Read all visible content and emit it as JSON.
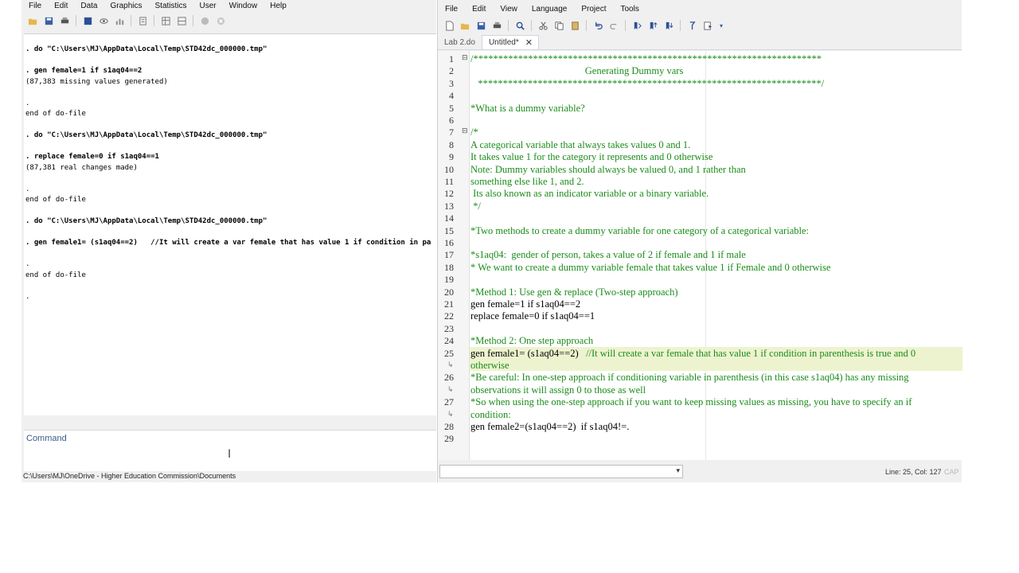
{
  "stata": {
    "menu": [
      "File",
      "Edit",
      "Data",
      "Graphics",
      "Statistics",
      "User",
      "Window",
      "Help"
    ],
    "results": [
      {
        "text": ". do \"C:\\Users\\MJ\\AppData\\Local\\Temp\\STD42dc_000000.tmp\"",
        "cmd": true
      },
      {
        "text": ". gen female=1 if s1aq04==2",
        "cmd": true
      },
      {
        "text": "(87,383 missing values generated)",
        "cmd": false
      },
      {
        "text": ".",
        "cmd": false
      },
      {
        "text": "end of do-file",
        "cmd": false
      },
      {
        "text": ". do \"C:\\Users\\MJ\\AppData\\Local\\Temp\\STD42dc_000000.tmp\"",
        "cmd": true
      },
      {
        "text": ". replace female=0 if s1aq04==1",
        "cmd": true
      },
      {
        "text": "(87,381 real changes made)",
        "cmd": false
      },
      {
        "text": ".",
        "cmd": false
      },
      {
        "text": "end of do-file",
        "cmd": false
      },
      {
        "text": ". do \"C:\\Users\\MJ\\AppData\\Local\\Temp\\STD42dc_000000.tmp\"",
        "cmd": true
      },
      {
        "text": ". gen female1= (s1aq04==2)   //It will create a var female that has value 1 if condition in pa",
        "cmd": true
      },
      {
        "text": ".",
        "cmd": false
      },
      {
        "text": "end of do-file",
        "cmd": false
      },
      {
        "text": ".",
        "cmd": false
      }
    ],
    "command_label": "Command",
    "command_value": "",
    "cwd": "C:\\Users\\MJ\\OneDrive - Higher Education Commission\\Documents"
  },
  "editor": {
    "menu": [
      "File",
      "Edit",
      "View",
      "Language",
      "Project",
      "Tools"
    ],
    "tabs": [
      {
        "label": "Lab 2.do",
        "active": false
      },
      {
        "label": "Untitled*",
        "active": true
      }
    ],
    "tab_close_glyph": "✕",
    "lines": [
      {
        "n": "1",
        "text": "/**********************************************************************",
        "color": "comment"
      },
      {
        "n": "2",
        "text": "                                              Generating Dummy vars",
        "color": "comment"
      },
      {
        "n": "3",
        "text": "   *********************************************************************/",
        "color": "comment"
      },
      {
        "n": "4",
        "text": "",
        "color": "comment"
      },
      {
        "n": "5",
        "text": "*What is a dummy variable?",
        "color": "comment"
      },
      {
        "n": "6",
        "text": "",
        "color": "comment"
      },
      {
        "n": "7",
        "text": "/*",
        "color": "comment"
      },
      {
        "n": "8",
        "text": "A categorical variable that always takes values 0 and 1.",
        "color": "comment"
      },
      {
        "n": "9",
        "text": "It takes value 1 for the category it represents and 0 otherwise",
        "color": "comment"
      },
      {
        "n": "10",
        "text": "Note: Dummy variables should always be valued 0, and 1 rather than",
        "color": "comment"
      },
      {
        "n": "11",
        "text": "something else like 1, and 2.",
        "color": "comment"
      },
      {
        "n": "12",
        "text": " Its also known as an indicator variable or a binary variable.",
        "color": "comment"
      },
      {
        "n": "13",
        "text": " */",
        "color": "comment"
      },
      {
        "n": "14",
        "text": "",
        "color": "comment"
      },
      {
        "n": "15",
        "text": "*Two methods to create a dummy variable for one category of a categorical variable:",
        "color": "comment"
      },
      {
        "n": "16",
        "text": "",
        "color": "comment"
      },
      {
        "n": "17",
        "text": "*s1aq04:  gender of person, takes a value of 2 if female and 1 if male",
        "color": "comment"
      },
      {
        "n": "18",
        "text": "* We want to create a dummy variable female that takes value 1 if Female and 0 otherwise",
        "color": "comment"
      },
      {
        "n": "19",
        "text": "",
        "color": "comment"
      },
      {
        "n": "20",
        "text": "*Method 1: Use gen & replace (Two-step approach)",
        "color": "comment"
      },
      {
        "n": "21",
        "text": "gen female=1 if s1aq04==2",
        "color": "code"
      },
      {
        "n": "22",
        "text": "replace female=0 if s1aq04==1",
        "color": "code"
      },
      {
        "n": "23",
        "text": "",
        "color": "comment"
      },
      {
        "n": "24",
        "text": "*Method 2: One step approach",
        "color": "comment"
      },
      {
        "n": "25",
        "text": "gen female1= (s1aq04==2)",
        "color": "code",
        "trail": "   //It will create a var female that has value 1 if condition in parenthesis is true and 0",
        "highlight": true
      },
      {
        "n": "",
        "text": "otherwise",
        "color": "comment",
        "wrap": true,
        "highlight": true
      },
      {
        "n": "26",
        "text": "*Be careful: In one-step approach if conditioning variable in parenthesis (in this case s1aq04) has any missing",
        "color": "comment"
      },
      {
        "n": "",
        "text": "observations it will assign 0 to those as well",
        "color": "comment",
        "wrap": true
      },
      {
        "n": "27",
        "text": "*So when using the one-step approach if you want to keep missing values as missing, you have to specify an if",
        "color": "comment"
      },
      {
        "n": "",
        "text": "condition:",
        "color": "comment",
        "wrap": true
      },
      {
        "n": "28",
        "text": "gen female2=(s1aq04==2)  if s1aq04!=.",
        "color": "code"
      },
      {
        "n": "29",
        "text": "",
        "color": "comment"
      }
    ],
    "status_position": "Line: 25, Col: 127",
    "status_cap": "CAP"
  }
}
